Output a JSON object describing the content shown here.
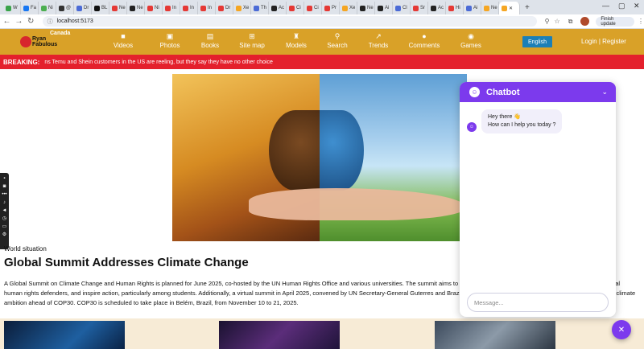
{
  "browser": {
    "tabs": [
      {
        "label": "W",
        "color": "#3aa34a"
      },
      {
        "label": "Fa",
        "color": "#1877f2"
      },
      {
        "label": "Ni",
        "color": "#4caf50"
      },
      {
        "label": "@",
        "color": "#333333"
      },
      {
        "label": "Dr",
        "color": "#4b6bd6"
      },
      {
        "label": "BL",
        "color": "#111111"
      },
      {
        "label": "Ne",
        "color": "#e53935"
      },
      {
        "label": "Ne",
        "color": "#222222"
      },
      {
        "label": "Ni",
        "color": "#e53935"
      },
      {
        "label": "In",
        "color": "#e53935"
      },
      {
        "label": "In",
        "color": "#e53935"
      },
      {
        "label": "In",
        "color": "#e53935"
      },
      {
        "label": "Dr",
        "color": "#e53935"
      },
      {
        "label": "Xe",
        "color": "#f5a623"
      },
      {
        "label": "Th",
        "color": "#4b6bd6"
      },
      {
        "label": "Ac",
        "color": "#222222"
      },
      {
        "label": "Ci",
        "color": "#e53935"
      },
      {
        "label": "Ci",
        "color": "#e53935"
      },
      {
        "label": "Pr",
        "color": "#e53935"
      },
      {
        "label": "Xe",
        "color": "#f5a623"
      },
      {
        "label": "Ne",
        "color": "#222222"
      },
      {
        "label": "Ai",
        "color": "#222222"
      },
      {
        "label": "Cl",
        "color": "#4b6bd6"
      },
      {
        "label": "Sr",
        "color": "#e53935"
      },
      {
        "label": "Ac",
        "color": "#222222"
      },
      {
        "label": "Hi",
        "color": "#e53935"
      },
      {
        "label": "Ai",
        "color": "#4b6bd6"
      },
      {
        "label": "Ne",
        "color": "#f5a623"
      }
    ],
    "active_tab_label": "",
    "address": "localhost:5173",
    "finish_update": "Finish update"
  },
  "site": {
    "logo_line1": "Ryan",
    "logo_line2": "Fabulous",
    "country": "Canada",
    "nav": [
      {
        "label": "Videos",
        "icon": "video-icon",
        "glyph": "■"
      },
      {
        "label": "Photos",
        "icon": "photo-icon",
        "glyph": "▣"
      },
      {
        "label": "Books",
        "icon": "book-icon",
        "glyph": "▤"
      },
      {
        "label": "Site map",
        "icon": "sitemap-icon",
        "glyph": "⊞"
      },
      {
        "label": "Models",
        "icon": "models-icon",
        "glyph": "♜"
      },
      {
        "label": "Search",
        "icon": "search-icon",
        "glyph": "⚲"
      },
      {
        "label": "Trends",
        "icon": "trends-icon",
        "glyph": "↗"
      },
      {
        "label": "Comments",
        "icon": "comments-icon",
        "glyph": "●"
      },
      {
        "label": "Games",
        "icon": "games-icon",
        "glyph": "◉"
      }
    ],
    "language": "English",
    "login": "Login",
    "separator": "|",
    "register": "Register",
    "header_color": "#d9a128",
    "breaking_color": "#e4202c"
  },
  "breaking": {
    "label": "BREAKING:",
    "text": "ns     Temu and Shein customers in the US are reeling, but they say they have no other choice"
  },
  "article": {
    "category": "World situation",
    "title": "Global Summit Addresses Climate Change",
    "body": "A Global Summit on Climate Change and Human Rights is planned for June 2025, co-hosted by the UN Human Rights Office and various universities. The summit aims to advance climate justice, amplify the voices of environmental human rights defenders, and inspire action, particularly among students. Additionally, a virtual summit in April 2025, convened by UN Secretary-General Guterres and Brazil's President Lula da Silva, focused on accelerating global climate ambition ahead of COP30. COP30 is scheduled to take place in Belém, Brazil, from November 10 to 21, 2025."
  },
  "chatbot": {
    "title": "Chatbot",
    "greeting_line1": "Hey there 👋",
    "greeting_line2": "How can I help you today ?",
    "input_placeholder": "Message...",
    "accent": "#7c3aed"
  }
}
